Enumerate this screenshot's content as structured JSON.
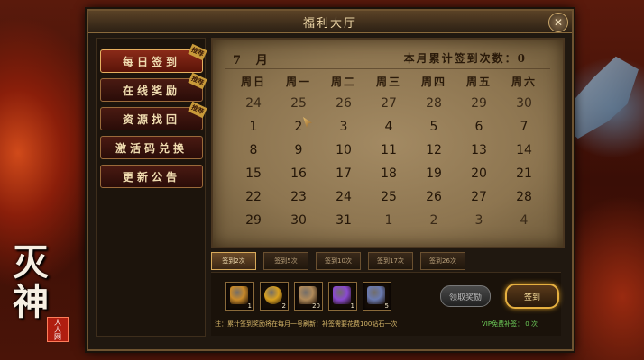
{
  "window": {
    "title": "福利大厅",
    "close_label": "✕"
  },
  "sidebar": {
    "items": [
      {
        "label": "每日签到",
        "tag": "推荐",
        "active": true
      },
      {
        "label": "在线奖励",
        "tag": "推荐"
      },
      {
        "label": "资源找回",
        "tag": "推荐"
      },
      {
        "label": "激活码兑换"
      },
      {
        "label": "更新公告"
      }
    ]
  },
  "calendar": {
    "month": "7 月",
    "cumulative_label": "本月累计签到次数：0",
    "weekdays": [
      "周日",
      "周一",
      "周二",
      "周三",
      "周四",
      "周五",
      "周六"
    ],
    "weeks": [
      [
        "24",
        "25",
        "26",
        "27",
        "28",
        "29",
        "30"
      ],
      [
        "1",
        "2",
        "3",
        "4",
        "5",
        "6",
        "7"
      ],
      [
        "8",
        "9",
        "10",
        "11",
        "12",
        "13",
        "14"
      ],
      [
        "15",
        "16",
        "17",
        "18",
        "19",
        "20",
        "21"
      ],
      [
        "22",
        "23",
        "24",
        "25",
        "26",
        "27",
        "28"
      ],
      [
        "29",
        "30",
        "31",
        "1",
        "2",
        "3",
        "4"
      ]
    ]
  },
  "streak_tabs": [
    "签到2次",
    "签到5次",
    "签到10次",
    "签到17次",
    "签到26次"
  ],
  "rewards": [
    {
      "icon": "treasure-chest-icon",
      "count": "1",
      "color": "#c98a2a"
    },
    {
      "icon": "gold-coin-icon",
      "count": "2",
      "color": "#d8a020"
    },
    {
      "icon": "scroll-icon",
      "count": "20",
      "color": "#b08a5a"
    },
    {
      "icon": "purple-crystal-icon",
      "count": "1",
      "color": "#8a4ad0"
    },
    {
      "icon": "potion-icon",
      "count": "5",
      "color": "#6a7ab0"
    }
  ],
  "buttons": {
    "claim": "领取奖励",
    "sign": "签到"
  },
  "footer": {
    "note": "注：累计签到奖励将在每月一号刷新！补签需要花费100钻石一次",
    "vip": "VIP免费补签： 0 次"
  },
  "logo": {
    "text_top": "灭",
    "text_bottom": "神",
    "seal": "人人网"
  }
}
